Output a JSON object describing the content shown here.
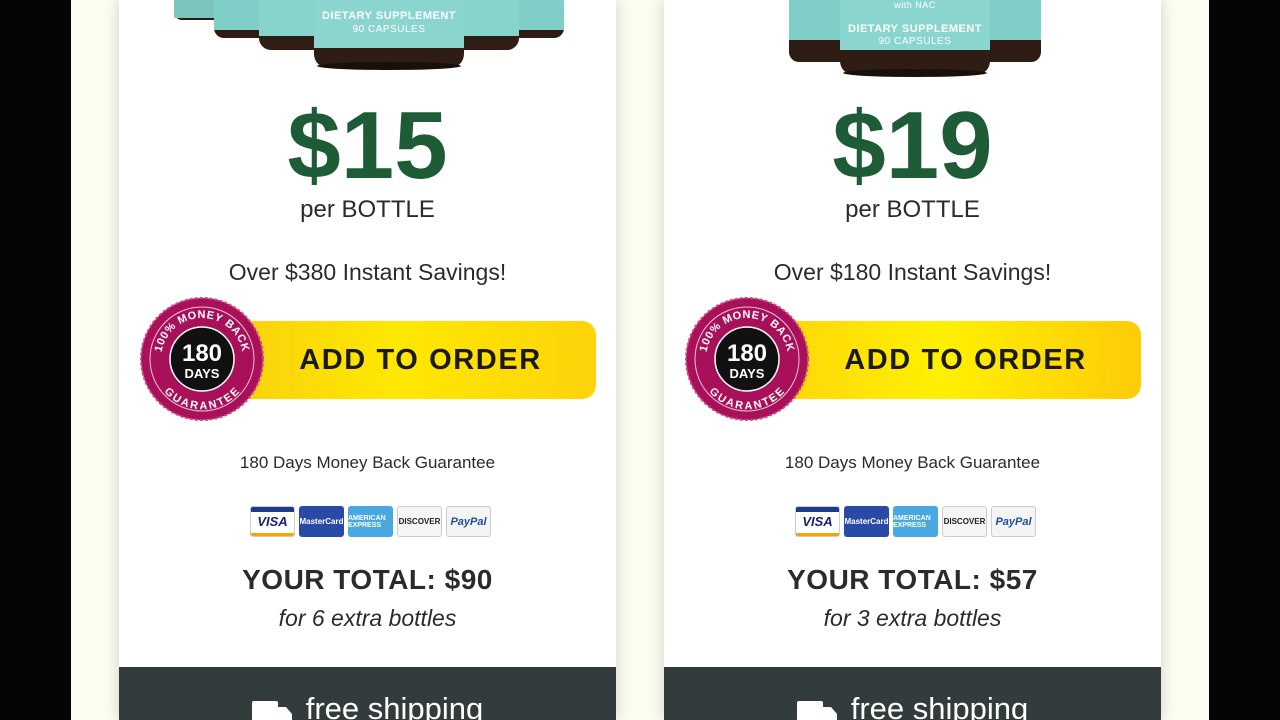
{
  "offers": [
    {
      "bottle_label_1": "DIETARY SUPPLEMENT",
      "bottle_label_2": "90 CAPSULES",
      "price": "$15",
      "per": "per BOTTLE",
      "savings": "Over $380 Instant Savings!",
      "button_label": "ADD TO ORDER",
      "badge": {
        "top": "100% MONEY BACK",
        "number": "180",
        "unit": "DAYS",
        "bottom": "GUARANTEE"
      },
      "guarantee": "180 Days Money Back Guarantee",
      "payment_methods": [
        "VISA",
        "MasterCard",
        "AMERICAN EXPRESS",
        "DISCOVER",
        "PayPal"
      ],
      "total": "YOUR TOTAL: $90",
      "extra": "for 6 extra bottles",
      "shipping": "free shipping"
    },
    {
      "bottle_label_0": "with NAC",
      "bottle_label_1": "DIETARY SUPPLEMENT",
      "bottle_label_2": "90 CAPSULES",
      "price": "$19",
      "per": "per BOTTLE",
      "savings": "Over $180 Instant Savings!",
      "button_label": "ADD TO ORDER",
      "badge": {
        "top": "100% MONEY BACK",
        "number": "180",
        "unit": "DAYS",
        "bottom": "GUARANTEE"
      },
      "guarantee": "180 Days Money Back Guarantee",
      "payment_methods": [
        "VISA",
        "MasterCard",
        "AMERICAN EXPRESS",
        "DISCOVER",
        "PayPal"
      ],
      "total": "YOUR TOTAL: $57",
      "extra": "for 3 extra bottles",
      "shipping": "free shipping"
    }
  ],
  "colors": {
    "price_green": "#1e5c38",
    "button_yellow": "#ffe800",
    "badge_magenta": "#a8115a",
    "shipping_bar": "#323c3d",
    "bottle_teal": "#7fcfc8"
  }
}
